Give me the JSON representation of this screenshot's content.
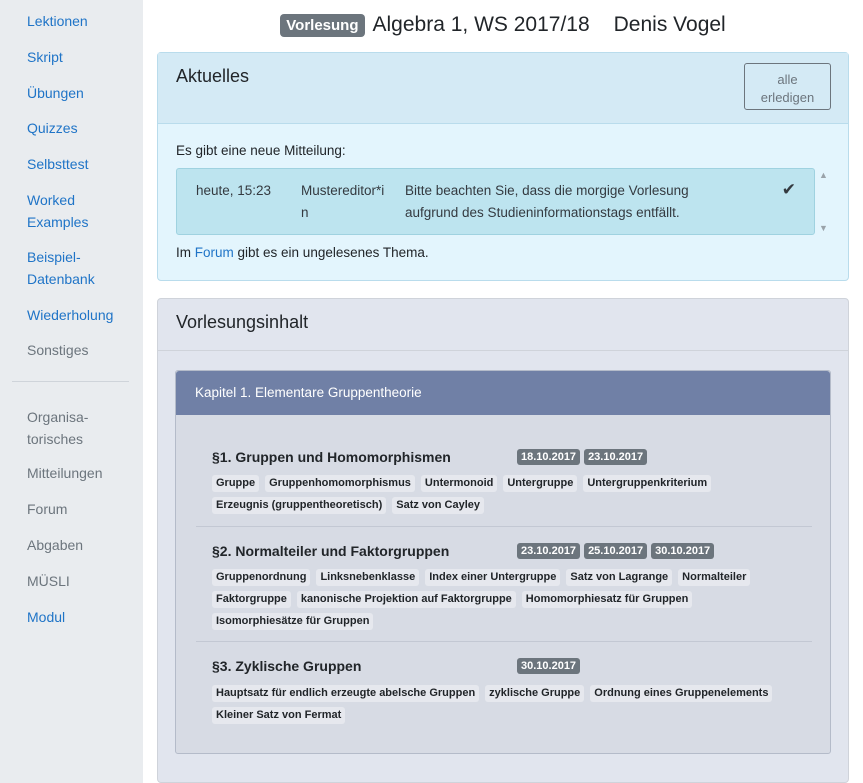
{
  "sidebar": {
    "primary": [
      {
        "label": "Lektionen",
        "style": "link"
      },
      {
        "label": "Skript",
        "style": "link"
      },
      {
        "label": "Übungen",
        "style": "link"
      },
      {
        "label": "Quizzes",
        "style": "link"
      },
      {
        "label": "Selbsttest",
        "style": "link"
      },
      {
        "label": "Worked\nExamples",
        "style": "link"
      },
      {
        "label": "Beispiel-\nDatenbank",
        "style": "link"
      },
      {
        "label": "Wiederholung",
        "style": "link"
      },
      {
        "label": "Sonstiges",
        "style": "muted"
      }
    ],
    "secondary": [
      {
        "label": "Organisa-\ntorisches",
        "style": "muted"
      },
      {
        "label": "Mitteilungen",
        "style": "muted"
      },
      {
        "label": "Forum",
        "style": "muted"
      },
      {
        "label": "Abgaben",
        "style": "muted"
      },
      {
        "label": "MÜSLI",
        "style": "muted"
      },
      {
        "label": "Modul",
        "style": "link"
      }
    ]
  },
  "header": {
    "badge": "Vorlesung",
    "title": "Algebra 1, WS 2017/18",
    "author": "Denis Vogel"
  },
  "aktuelles": {
    "title": "Aktuelles",
    "mark_all_label": "alle\nerledigen",
    "intro": "Es gibt eine neue Mitteilung:",
    "message": {
      "when": "heute, 15:23",
      "who": "Mustereditor*in",
      "text": "Bitte beachten Sie, dass die morgige Vorlesung aufgrund des Studieninformationstags entfällt."
    },
    "forum_prefix": "Im ",
    "forum_link": "Forum",
    "forum_suffix": " gibt es ein ungelesenes Thema."
  },
  "inhalt": {
    "title": "Vorlesungsinhalt",
    "chapter_title": "Kapitel 1. Elementare Gruppentheorie",
    "sections": [
      {
        "title": "§1. Gruppen und Homomorphismen",
        "dates": [
          "18.10.2017",
          "23.10.2017"
        ],
        "tags": [
          "Gruppe",
          "Gruppenhomomorphismus",
          "Untermonoid",
          "Untergruppe",
          "Untergruppenkriterium",
          "Erzeugnis (gruppentheoretisch)",
          "Satz von Cayley"
        ]
      },
      {
        "title": "§2. Normalteiler und Faktorgruppen",
        "dates": [
          "23.10.2017",
          "25.10.2017",
          "30.10.2017"
        ],
        "tags": [
          "Gruppenordnung",
          "Linksnebenklasse",
          "Index einer Untergruppe",
          "Satz von Lagrange",
          "Normalteiler",
          "Faktorgruppe",
          "kanonische Projektion auf Faktorgruppe",
          "Homomorphiesatz für Gruppen",
          "Isomorphiesätze für Gruppen"
        ]
      },
      {
        "title": "§3. Zyklische Gruppen",
        "dates": [
          "30.10.2017"
        ],
        "tags": [
          "Hauptsatz für endlich erzeugte abelsche Gruppen",
          "zyklische Gruppe",
          "Ordnung eines Gruppenelements",
          "Kleiner Satz von Fermat"
        ]
      }
    ]
  },
  "colors": {
    "link": "#1f74c7",
    "muted": "#6c757d",
    "chapter_header": "#7080a6",
    "info_bg": "#e3f5fd"
  }
}
